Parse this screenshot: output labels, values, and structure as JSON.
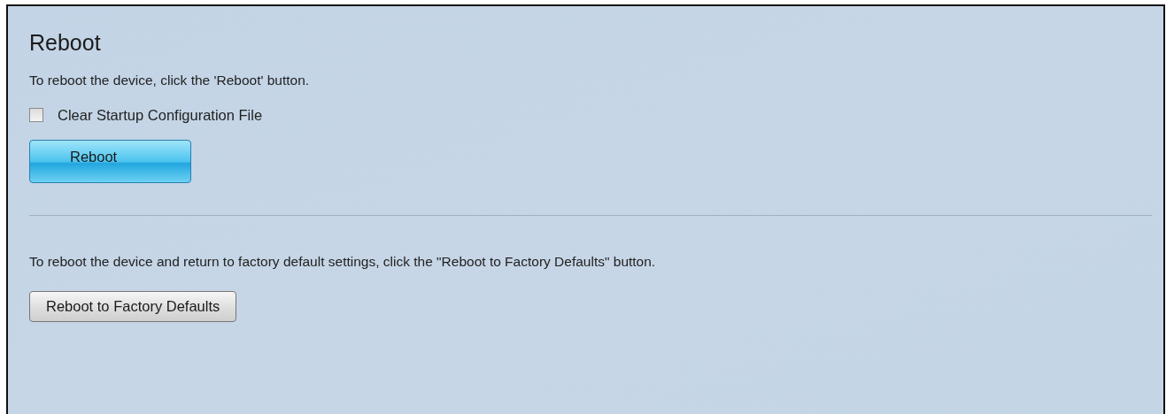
{
  "title": "Reboot",
  "reboot_instruction": "To reboot the device, click the 'Reboot' button.",
  "clear_startup_config": {
    "label": "Clear Startup Configuration File",
    "checked": false
  },
  "reboot_button": {
    "label": "Reboot",
    "primary": true
  },
  "factory_instruction": "To reboot the device and return to factory default settings, click the \"Reboot to Factory Defaults\" button.",
  "factory_button": {
    "label": "Reboot to Factory Defaults",
    "primary": false
  }
}
